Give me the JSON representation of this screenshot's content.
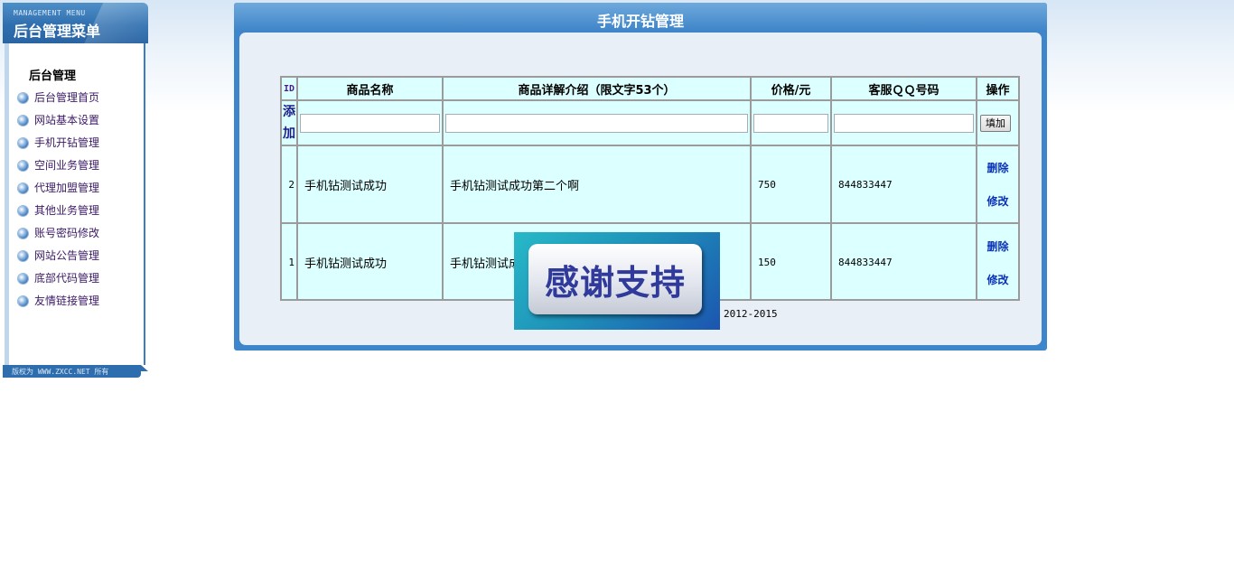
{
  "left_menu": {
    "subtitle": "MANAGEMENT MENU",
    "title": "后台管理菜单",
    "section": "后台管理",
    "items": [
      {
        "label": "后台管理首页"
      },
      {
        "label": "网站基本设置"
      },
      {
        "label": "手机开钻管理"
      },
      {
        "label": "空间业务管理"
      },
      {
        "label": "代理加盟管理"
      },
      {
        "label": "其他业务管理"
      },
      {
        "label": "账号密码修改"
      },
      {
        "label": "网站公告管理"
      },
      {
        "label": "底部代码管理"
      },
      {
        "label": "友情链接管理"
      }
    ],
    "copyright": "版权为 WWW.ZXCC.NET 所有"
  },
  "main": {
    "title": "手机开钻管理",
    "table": {
      "headers": [
        "ID",
        "商品名称",
        "商品详解介绍（限文字53个）",
        "价格/元",
        "客服ＱＱ号码",
        "操作"
      ],
      "add_row": {
        "label_1": "添",
        "label_2": "加",
        "name_value": "",
        "desc_value": "",
        "price_value": "",
        "qq_value": "",
        "button_label": "填加"
      },
      "rows": [
        {
          "id": "2",
          "name": "手机钻测试成功",
          "desc": "手机钻测试成功第二个啊",
          "price": "750",
          "qq": "844833447",
          "delete": "删除",
          "edit": "修改"
        },
        {
          "id": "1",
          "name": "手机钻测试成功",
          "desc": "手机钻测试成功",
          "price": "150",
          "qq": "844833447",
          "delete": "删除",
          "edit": "修改"
        }
      ]
    },
    "footer_year": "2012-2015"
  },
  "banner": {
    "text": "感谢支持"
  }
}
